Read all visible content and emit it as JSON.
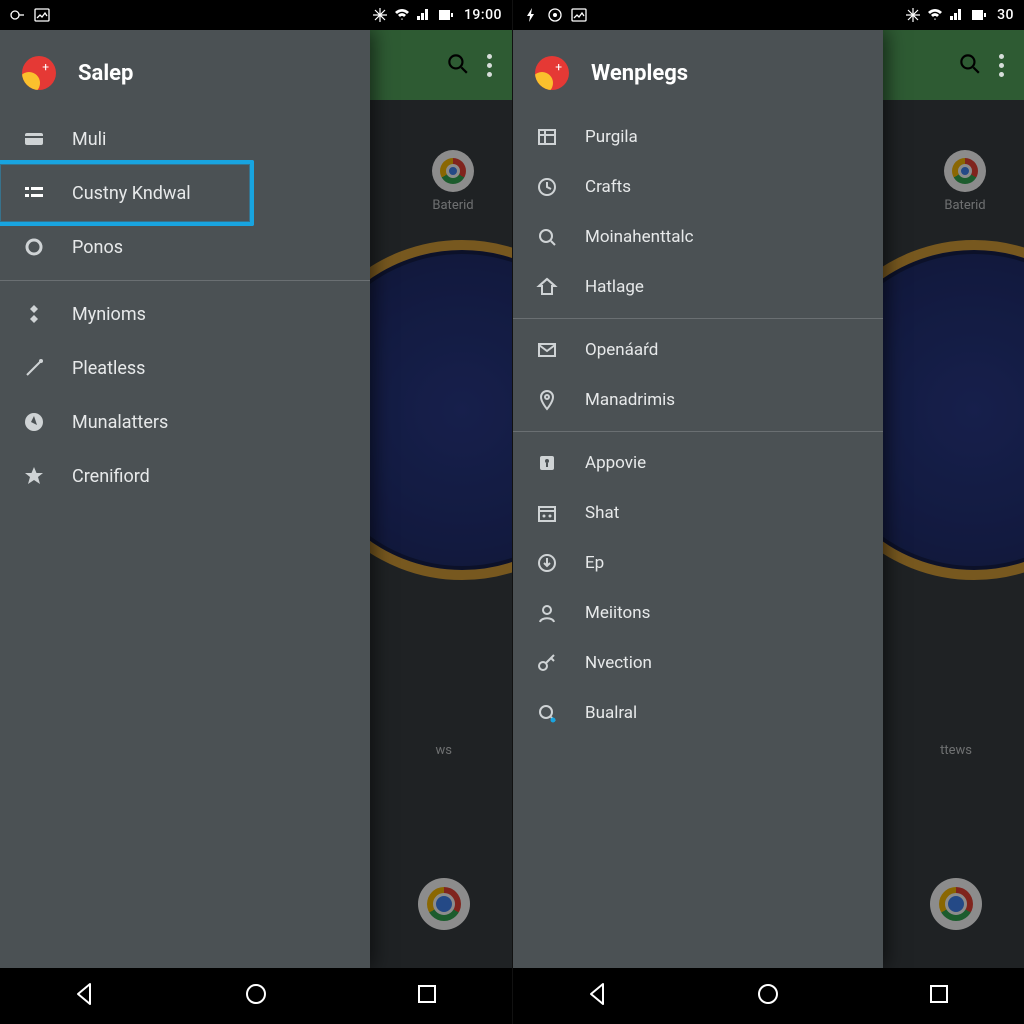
{
  "phones": [
    {
      "status": {
        "time": "19:00"
      },
      "bg": {
        "app_top": {
          "label": "Baterid"
        },
        "app_bottom": {
          "label": "ws"
        }
      },
      "drawer": {
        "title": "Salep",
        "section1": [
          {
            "icon": "card-icon",
            "label": "Muli",
            "selected": false
          },
          {
            "icon": "list-icon",
            "label": "Custny Kndwal",
            "selected": true
          },
          {
            "icon": "circle-icon",
            "label": "Ponos",
            "selected": false
          }
        ],
        "section2": [
          {
            "icon": "diamond-icon",
            "label": "Mynioms"
          },
          {
            "icon": "wand-icon",
            "label": "Pleatless"
          },
          {
            "icon": "compass-icon",
            "label": "Munalatters"
          },
          {
            "icon": "star-icon",
            "label": "Crenifiord"
          }
        ]
      }
    },
    {
      "status": {
        "time": "30"
      },
      "bg": {
        "app_top": {
          "label": "Baterid"
        },
        "app_bottom": {
          "label": "ttews"
        }
      },
      "drawer": {
        "title": "Wenplegs",
        "section1": [
          {
            "icon": "grid-icon",
            "label": "Purgila"
          },
          {
            "icon": "clock-icon",
            "label": "Crafts"
          },
          {
            "icon": "search-icon",
            "label": "Moinahenttalc"
          },
          {
            "icon": "home-icon",
            "label": "Hatlage"
          }
        ],
        "section2": [
          {
            "icon": "mail-icon",
            "label": "Openáaŕd"
          },
          {
            "icon": "pin-icon",
            "label": "Manadrimis"
          }
        ],
        "section3": [
          {
            "icon": "place-icon",
            "label": "Appovie"
          },
          {
            "icon": "date-icon",
            "label": "Shat"
          },
          {
            "icon": "download-icon",
            "label": "Ep"
          },
          {
            "icon": "person-icon",
            "label": "Meiitons"
          },
          {
            "icon": "key-icon",
            "label": "Nvection"
          },
          {
            "icon": "searchdot-icon",
            "label": "Bualral"
          }
        ]
      }
    }
  ]
}
